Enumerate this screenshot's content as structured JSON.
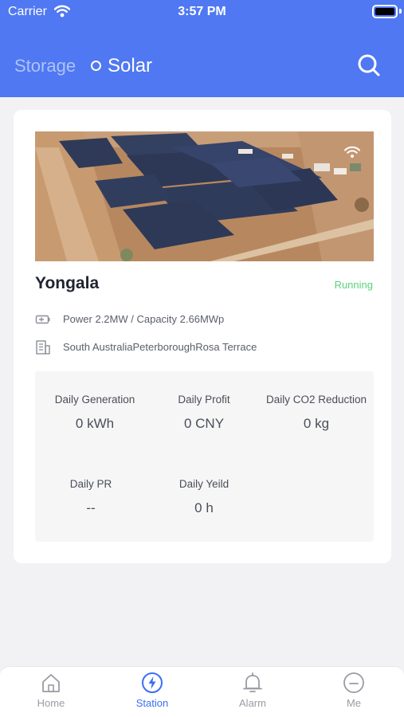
{
  "status_bar": {
    "carrier": "Carrier",
    "time": "3:57 PM"
  },
  "header": {
    "tabs": [
      {
        "label": "Storage",
        "active": false
      },
      {
        "label": "Solar",
        "active": true
      }
    ],
    "accent_color": "#4f78f2",
    "search_icon": "search-icon"
  },
  "station": {
    "name": "Yongala",
    "status": "Running",
    "status_color": "#5ad27a",
    "power_capacity": "Power 2.2MW / Capacity 2.66MWp",
    "address": "South AustraliaPeterboroughRosa Terrace",
    "image_icon": "wifi-signal-icon"
  },
  "stats": [
    {
      "label": "Daily Generation",
      "value": "0",
      "unit": "kWh"
    },
    {
      "label": "Daily Profit",
      "value": "0",
      "unit": "CNY"
    },
    {
      "label": "Daily CO2 Reduction",
      "value": "0",
      "unit": "kg"
    },
    {
      "label": "Daily PR",
      "value": "--",
      "unit": ""
    },
    {
      "label": "Daily Yeild",
      "value": "0",
      "unit": "h"
    }
  ],
  "bottom_nav": [
    {
      "label": "Home",
      "icon": "home-icon",
      "active": false
    },
    {
      "label": "Station",
      "icon": "lightning-icon",
      "active": true
    },
    {
      "label": "Alarm",
      "icon": "bell-icon",
      "active": false
    },
    {
      "label": "Me",
      "icon": "user-icon",
      "active": false
    }
  ]
}
